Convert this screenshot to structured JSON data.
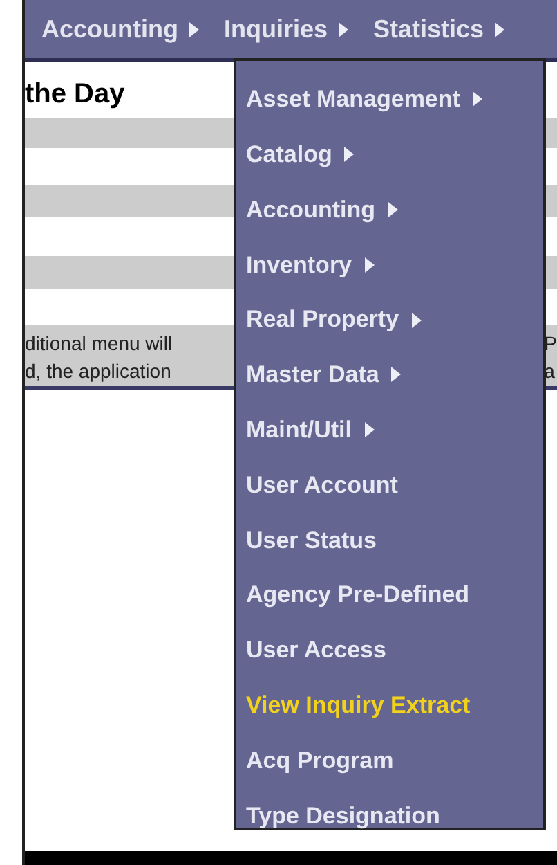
{
  "menu_bar": [
    {
      "label": "Accounting",
      "submenu": true
    },
    {
      "label": "Inquiries",
      "submenu": true
    },
    {
      "label": "Statistics",
      "submenu": true
    }
  ],
  "heading": "the Day",
  "notice": {
    "left_lines": [
      "ditional menu will",
      "d, the application"
    ],
    "right_lines": [
      "P",
      "a"
    ]
  },
  "dropdown": [
    {
      "label": "Asset Management",
      "submenu": true,
      "selected": false
    },
    {
      "label": "Catalog",
      "submenu": true,
      "selected": false
    },
    {
      "label": "Accounting",
      "submenu": true,
      "selected": false
    },
    {
      "label": "Inventory",
      "submenu": true,
      "selected": false
    },
    {
      "label": "Real Property",
      "submenu": true,
      "selected": false
    },
    {
      "label": "Master Data",
      "submenu": true,
      "selected": false
    },
    {
      "label": "Maint/Util",
      "submenu": true,
      "selected": false
    },
    {
      "label": "User Account",
      "submenu": false,
      "selected": false
    },
    {
      "label": "User Status",
      "submenu": false,
      "selected": false
    },
    {
      "label": "Agency Pre-Defined",
      "submenu": false,
      "selected": false
    },
    {
      "label": "User Access",
      "submenu": false,
      "selected": false
    },
    {
      "label": "View Inquiry Extract",
      "submenu": false,
      "selected": true
    },
    {
      "label": "Acq Program",
      "submenu": false,
      "selected": false
    },
    {
      "label": "Type Designation",
      "submenu": false,
      "selected": false
    }
  ]
}
